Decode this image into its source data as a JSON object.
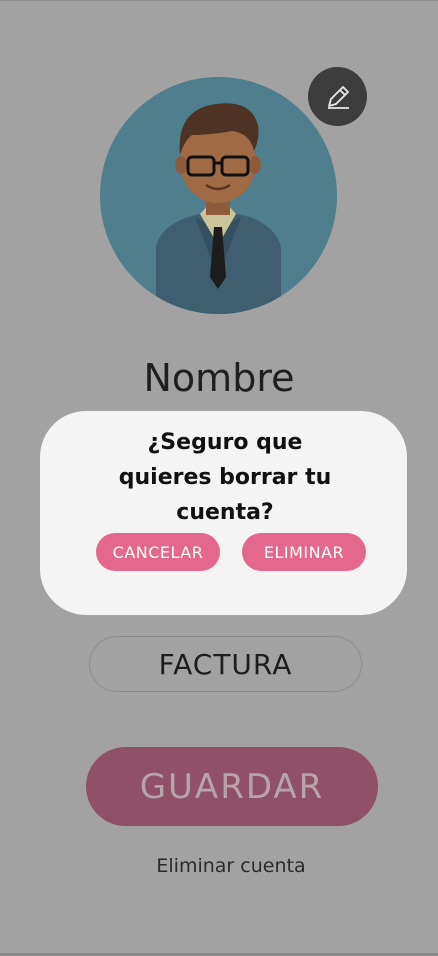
{
  "profile": {
    "name": "Nombre"
  },
  "dialog": {
    "line1": "¿Seguro que",
    "line2": "quieres borrar tu",
    "line3": "cuenta?",
    "cancel_label": "CANCELAR",
    "confirm_label": "ELIMINAR"
  },
  "buttons": {
    "invoice_label": "FACTURA",
    "save_label": "GUARDAR"
  },
  "links": {
    "delete_account": "Eliminar cuenta"
  },
  "icons": {
    "edit": "pencil-icon"
  },
  "colors": {
    "accent": "#e4688d",
    "overlay_background": "#a2a2a2",
    "dialog_background": "#f4f4f4",
    "save_button": "#905068"
  }
}
